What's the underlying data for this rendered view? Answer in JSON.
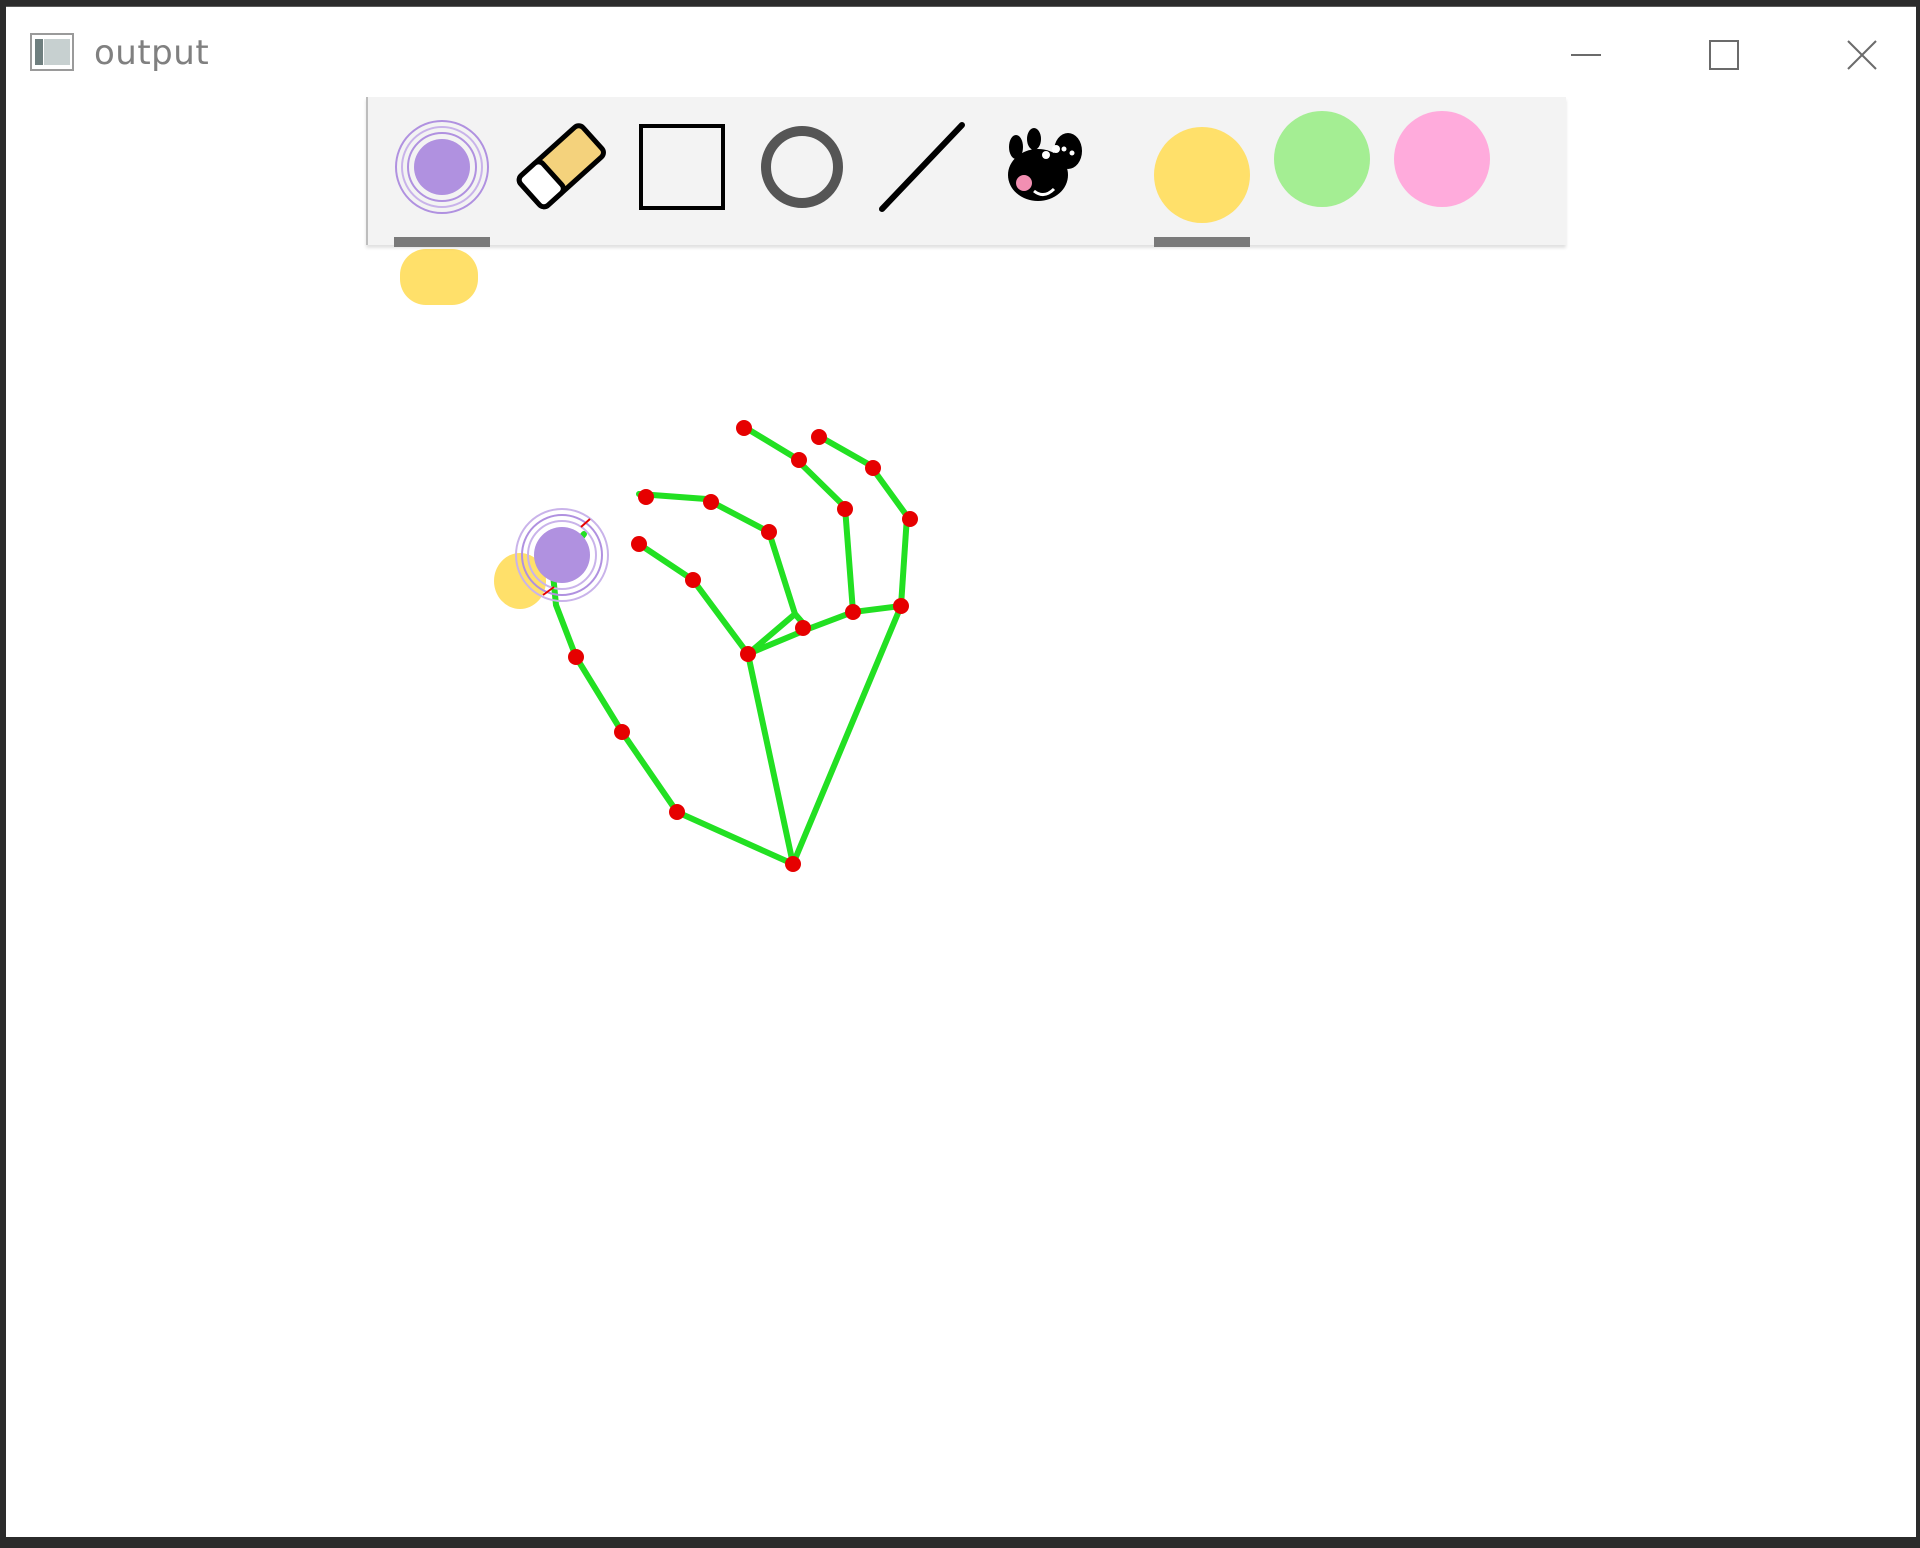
{
  "window": {
    "title": "output"
  },
  "title_bar": {
    "buttons": [
      "minimize",
      "maximize",
      "close"
    ]
  },
  "toolbar": {
    "tools": [
      {
        "name": "brush",
        "icon": "brush-target-icon",
        "selected": true
      },
      {
        "name": "eraser",
        "icon": "eraser-icon",
        "selected": false
      },
      {
        "name": "rectangle",
        "icon": "rectangle-icon",
        "selected": false
      },
      {
        "name": "circle",
        "icon": "circle-icon",
        "selected": false
      },
      {
        "name": "line",
        "icon": "line-icon",
        "selected": false
      },
      {
        "name": "peppa-pig",
        "icon": "peppa-pig-icon",
        "selected": false
      }
    ],
    "colors": [
      {
        "name": "yellow",
        "hex": "#ffe06a",
        "selected": true
      },
      {
        "name": "green",
        "hex": "#a4ee93",
        "selected": false
      },
      {
        "name": "pink",
        "hex": "#ffabdc",
        "selected": false
      }
    ]
  },
  "canvas": {
    "brush_color": "#b091e0",
    "skeleton_line_color": "#22e022",
    "landmark_color": "#e60000",
    "stroke_color": "#ffe06a"
  }
}
